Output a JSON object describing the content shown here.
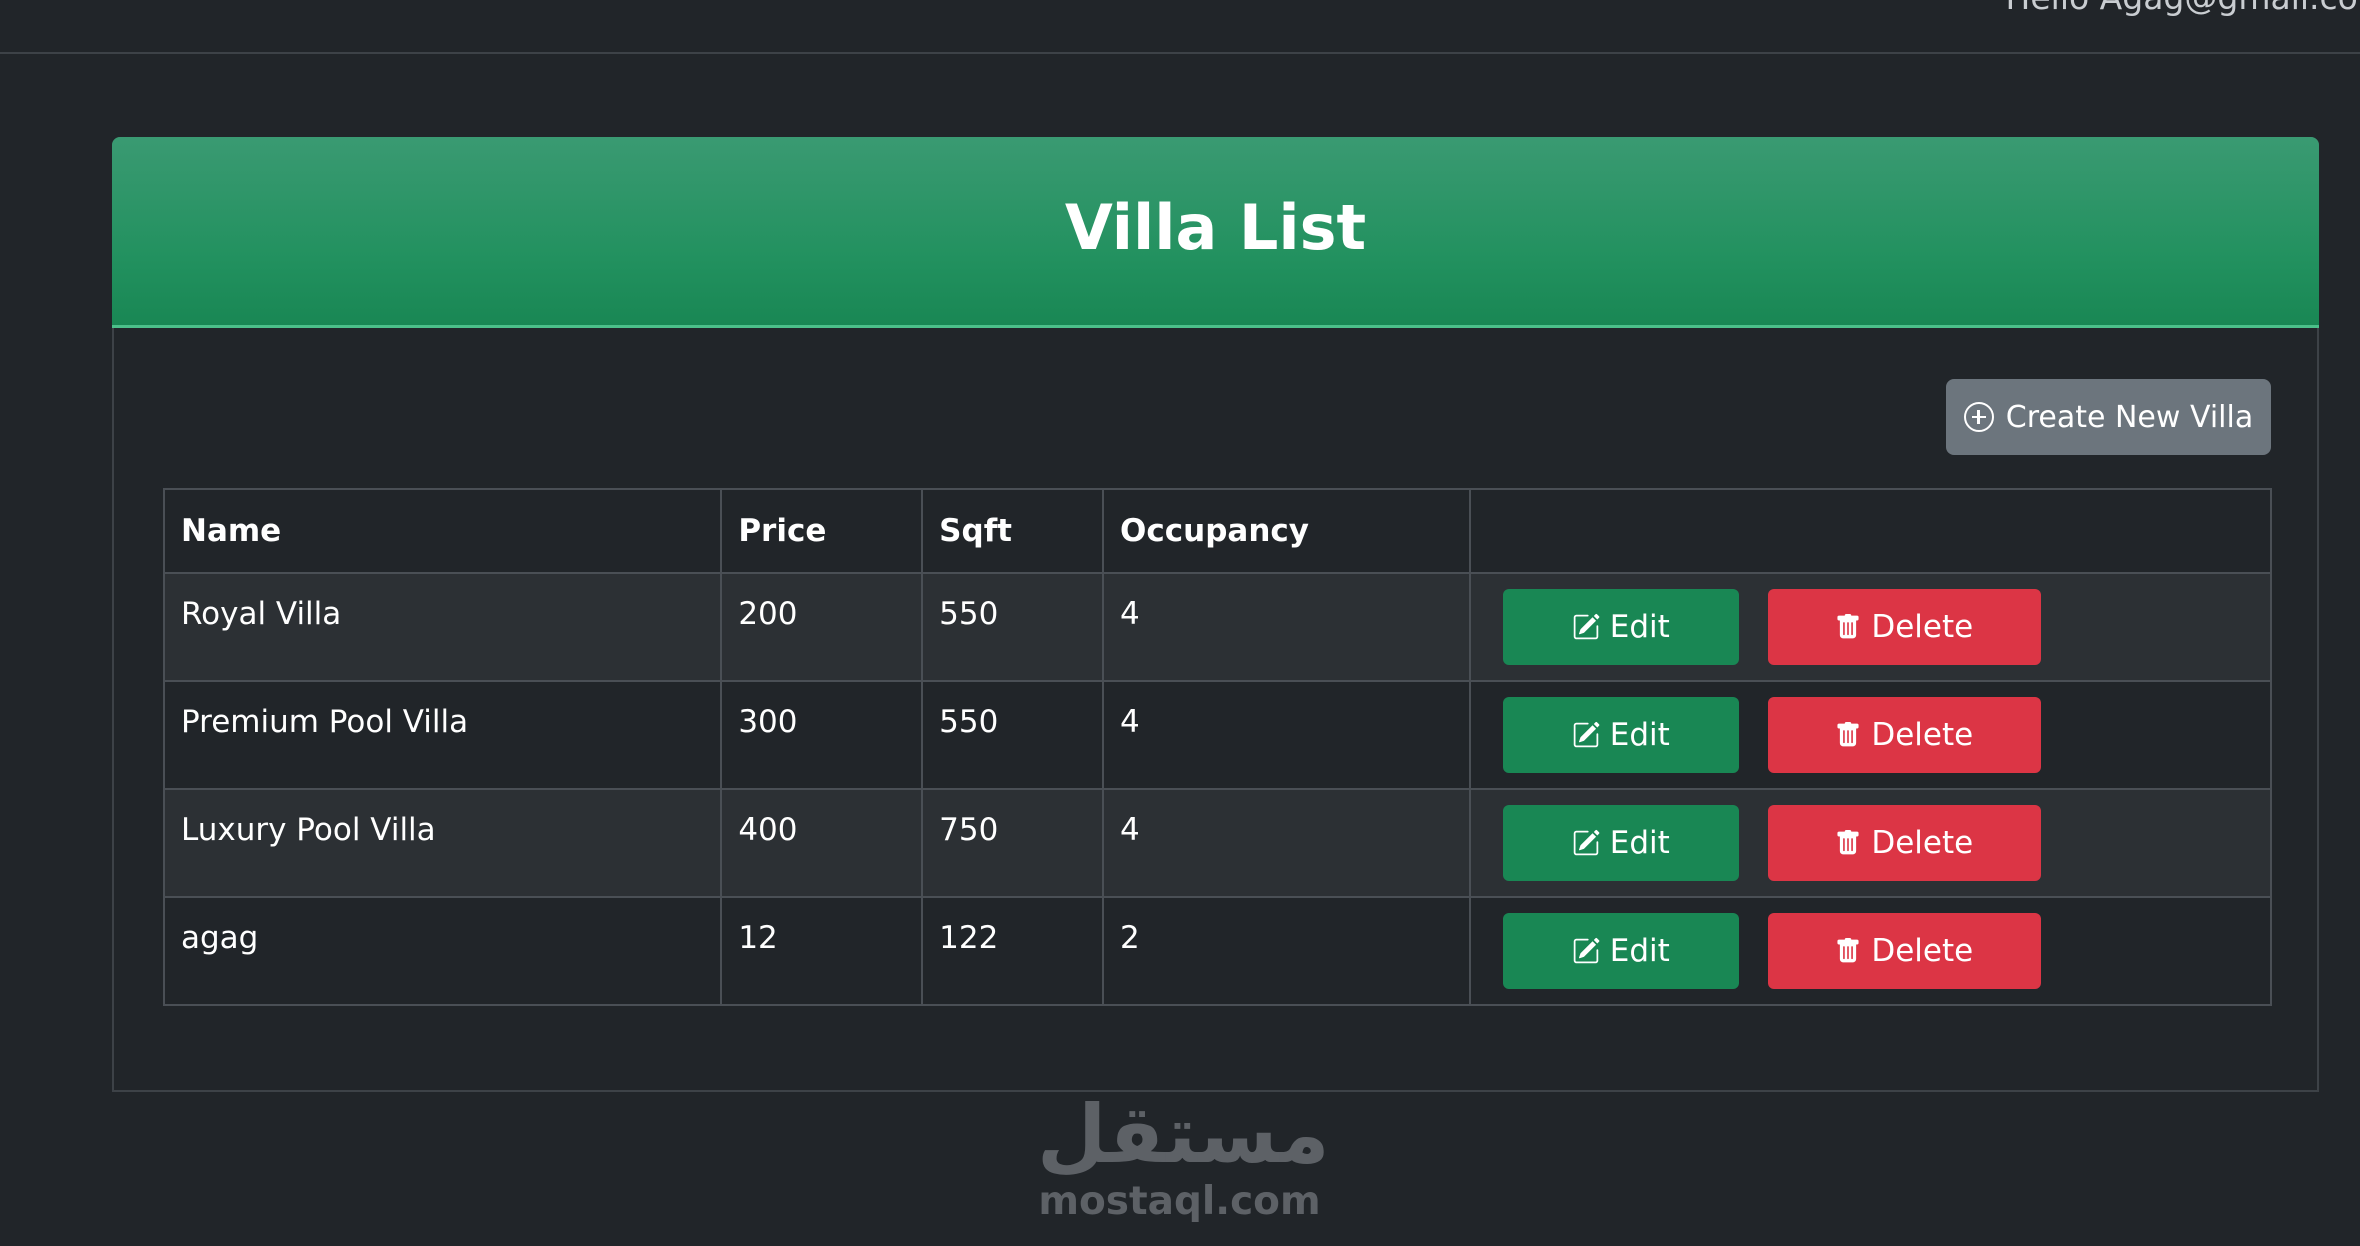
{
  "header": {
    "greeting": "Hello Agag@gmail.com"
  },
  "card": {
    "title": "Villa List",
    "create_button_label": "Create New Villa"
  },
  "table": {
    "columns": [
      "Name",
      "Price",
      "Sqft",
      "Occupancy",
      ""
    ],
    "rows": [
      {
        "name": "Royal Villa",
        "price": "200",
        "sqft": "550",
        "occupancy": "4"
      },
      {
        "name": "Premium Pool Villa",
        "price": "300",
        "sqft": "550",
        "occupancy": "4"
      },
      {
        "name": "Luxury Pool Villa",
        "price": "400",
        "sqft": "750",
        "occupancy": "4"
      },
      {
        "name": "agag",
        "price": "12",
        "sqft": "122",
        "occupancy": "2"
      }
    ],
    "edit_label": "Edit",
    "delete_label": "Delete"
  },
  "watermark": {
    "arabic": "مستقل",
    "latin": "mostaql.com"
  },
  "colors": {
    "background": "#212529",
    "header_green": "#198754",
    "edit_green": "#198754",
    "delete_red": "#dc3545",
    "secondary_gray": "#6c757d"
  },
  "icons": {
    "create": "plus-circle-icon",
    "edit": "pencil-square-icon",
    "delete": "trash-icon"
  }
}
